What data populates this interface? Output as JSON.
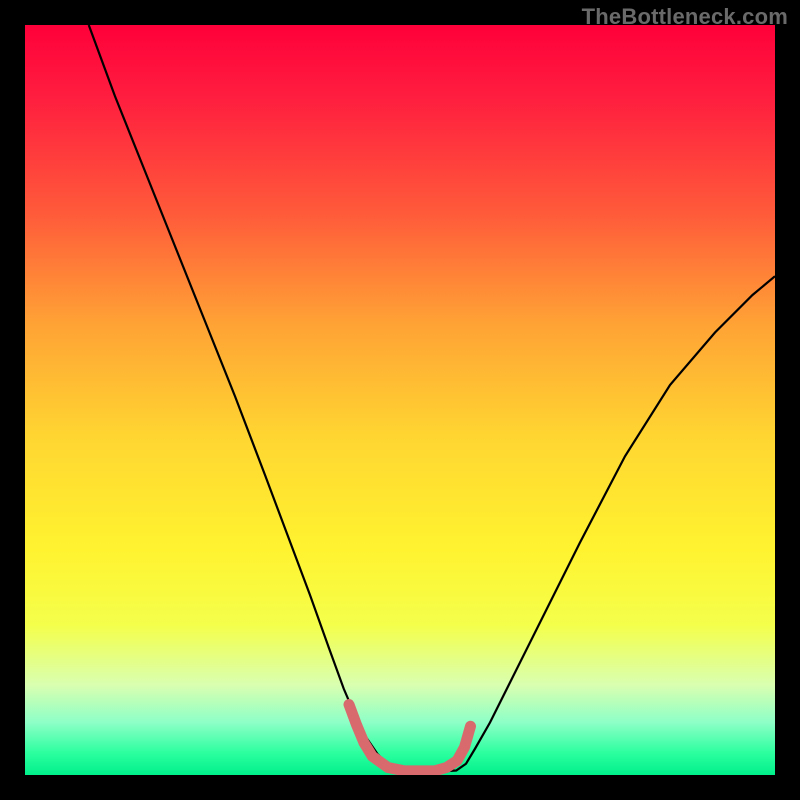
{
  "watermark": "TheBottleneck.com",
  "chart_data": {
    "type": "line",
    "title": "",
    "xlabel": "",
    "ylabel": "",
    "xlim": [
      0,
      100
    ],
    "ylim": [
      0,
      100
    ],
    "gradient_stops": [
      {
        "pos": 0.0,
        "color": "#ff003a"
      },
      {
        "pos": 0.1,
        "color": "#ff1f3f"
      },
      {
        "pos": 0.25,
        "color": "#ff5a3a"
      },
      {
        "pos": 0.4,
        "color": "#ffa335"
      },
      {
        "pos": 0.55,
        "color": "#ffd631"
      },
      {
        "pos": 0.7,
        "color": "#fff330"
      },
      {
        "pos": 0.8,
        "color": "#f4ff4b"
      },
      {
        "pos": 0.88,
        "color": "#d9ffb0"
      },
      {
        "pos": 0.93,
        "color": "#8dffc7"
      },
      {
        "pos": 0.97,
        "color": "#2dff9f"
      },
      {
        "pos": 1.0,
        "color": "#00f08b"
      }
    ],
    "series": [
      {
        "name": "bottleneck-dip",
        "stroke": "#000000",
        "width": 2.2,
        "x": [
          8.5,
          12,
          16,
          20,
          24,
          28,
          32,
          35,
          38,
          40.5,
          42.5,
          44,
          45.5,
          47,
          48.5,
          49.5,
          50.5,
          54,
          57.5,
          58.8,
          60,
          62,
          65,
          69,
          74,
          80,
          86,
          92,
          97,
          100
        ],
        "y": [
          100,
          90.5,
          80.5,
          70.5,
          60.5,
          50.5,
          40,
          32,
          24,
          17,
          11.5,
          8,
          5,
          2.8,
          1.3,
          0.6,
          0.4,
          0.4,
          0.6,
          1.5,
          3.5,
          7,
          13,
          21,
          31,
          42.5,
          52,
          59,
          64,
          66.5
        ]
      },
      {
        "name": "min-marker",
        "stroke": "#d86a6e",
        "width": 11,
        "linecap": "round",
        "x": [
          43.2,
          44.2,
          45.2,
          46.3,
          48.4,
          50.6,
          54.6,
          56.2,
          57.6,
          58.6,
          59.4
        ],
        "y": [
          9.4,
          6.7,
          4.3,
          2.5,
          1.0,
          0.55,
          0.55,
          1.0,
          1.9,
          3.7,
          6.5
        ]
      }
    ]
  }
}
